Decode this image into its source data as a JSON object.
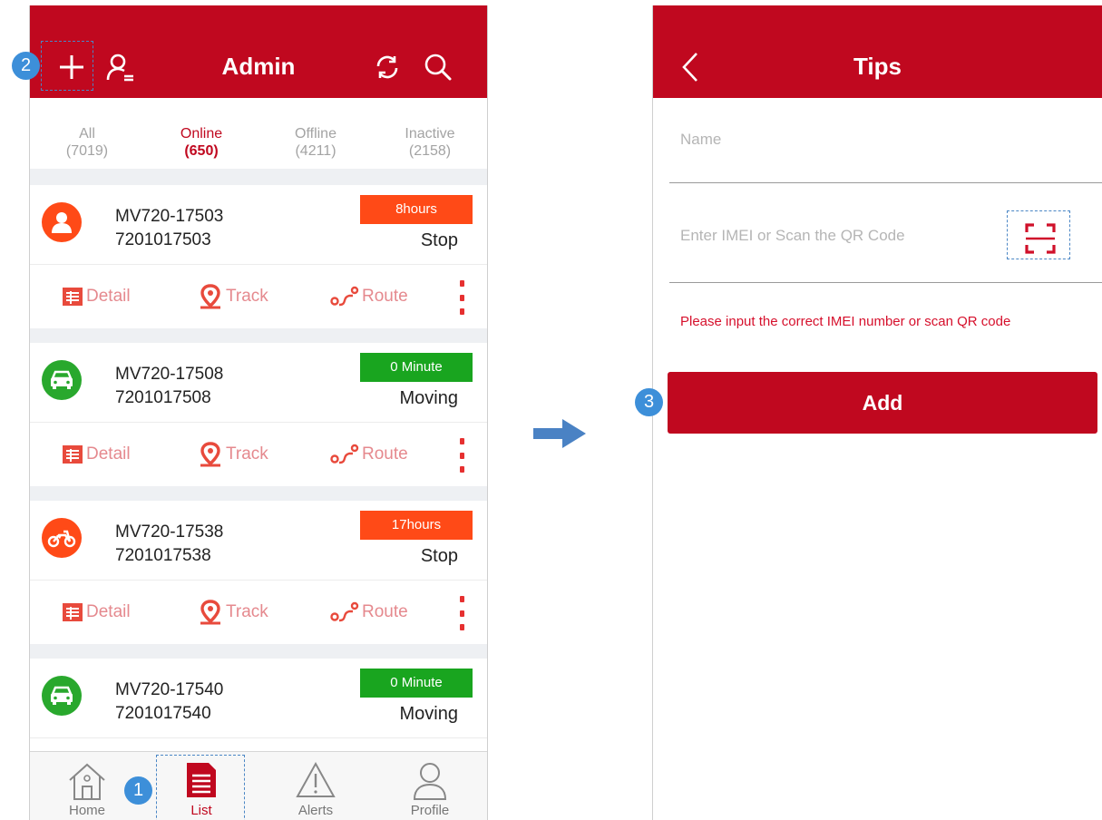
{
  "left_screen": {
    "header": {
      "title": "Admin",
      "icons": [
        "plus-icon",
        "user-list-icon",
        "refresh-icon",
        "search-icon"
      ]
    },
    "tabs": [
      {
        "label": "All",
        "count": "(7019)"
      },
      {
        "label": "Online",
        "count": "(650)",
        "active": true
      },
      {
        "label": "Offline",
        "count": "(4211)"
      },
      {
        "label": "Inactive",
        "count": "(2158)"
      }
    ],
    "devices": [
      {
        "name": "MV720-17503",
        "imei": "7201017503",
        "time": "8hours",
        "state": "Stop",
        "icon": "person-icon",
        "color": "#ff4a17",
        "badge_color": "#ff4a17"
      },
      {
        "name": "MV720-17508",
        "imei": "7201017508",
        "time": "0 Minute",
        "state": "Moving",
        "icon": "car-icon",
        "color": "#29a82d",
        "badge_color": "#19a51f"
      },
      {
        "name": "MV720-17538",
        "imei": "7201017538",
        "time": "17hours",
        "state": "Stop",
        "icon": "motorcycle-icon",
        "color": "#ff4a17",
        "badge_color": "#ff4a17"
      },
      {
        "name": "MV720-17540",
        "imei": "7201017540",
        "time": "0 Minute",
        "state": "Moving",
        "icon": "car-icon",
        "color": "#29a82d",
        "badge_color": "#19a51f"
      }
    ],
    "actions": {
      "detail": "Detail",
      "track": "Track",
      "route": "Route"
    },
    "nav": [
      {
        "label": "Home",
        "icon": "home-icon"
      },
      {
        "label": "List",
        "icon": "list-icon",
        "active": true
      },
      {
        "label": "Alerts",
        "icon": "alert-icon"
      },
      {
        "label": "Profile",
        "icon": "profile-icon"
      }
    ]
  },
  "right_screen": {
    "header": {
      "title": "Tips"
    },
    "name_placeholder": "Name",
    "imei_placeholder": "Enter IMEI or Scan the QR Code",
    "error": "Please input the correct IMEI number or scan QR code",
    "add_label": "Add"
  },
  "steps": [
    "1",
    "2",
    "3"
  ],
  "colors": {
    "primary": "#c0081f",
    "online": "#19a51f",
    "stop": "#ff4a17",
    "step": "#3d8fd9",
    "action": "#e5898e"
  }
}
